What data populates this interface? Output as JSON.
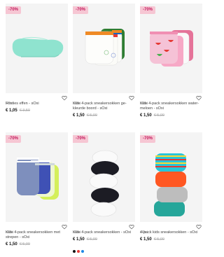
{
  "discount_label": "-70%",
  "products": [
    {
      "brand": "sOxi",
      "name": "Footies effen - sOxi",
      "price": "€ 1,05",
      "old_price": "€ 3,50"
    },
    {
      "brand": "sOxi",
      "name": "Kids 4-pack sneakersokken ge-kleurde boord - sOxi",
      "price": "€ 1,50",
      "old_price": "€ 5,00"
    },
    {
      "brand": "sOxi",
      "name": "Kids 4-pack sneakersokken water-meloen - sOxi",
      "price": "€ 1,50",
      "old_price": "€ 5,00"
    },
    {
      "brand": "sOxi",
      "name": "Kids 4-pack sneakersokken met strepen - sOxi",
      "price": "€ 1,50",
      "old_price": "€ 5,00"
    },
    {
      "brand": "sOxi",
      "name": "Kids 4-pack sneakersokken - sOxi",
      "price": "€ 1,50",
      "old_price": "€ 5,00",
      "swatch_colors": [
        "#111111",
        "#e53935",
        "#1e88e5"
      ]
    },
    {
      "brand": "sOxi",
      "name": "4-pack kids sneakersokken - sOxi",
      "price": "€ 1,50",
      "old_price": "€ 5,00"
    }
  ],
  "colors": {
    "badge_bg": "#f6c6d3",
    "badge_text": "#c2185b",
    "mint": "#8fe3cf"
  }
}
